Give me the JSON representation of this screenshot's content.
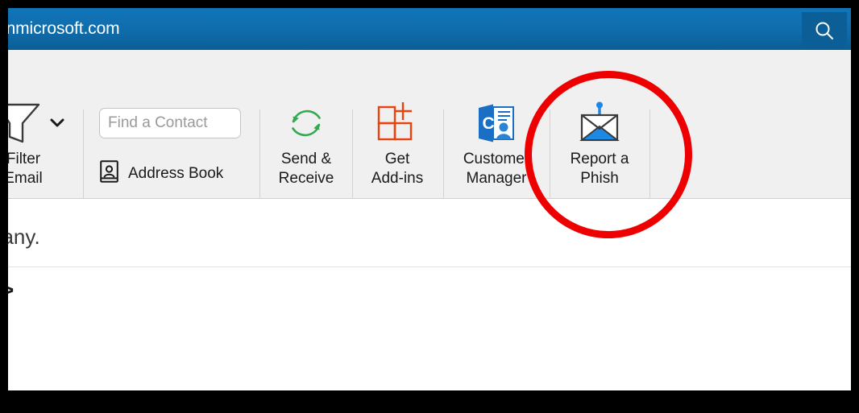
{
  "window": {
    "titlebar": {
      "text": "onmicrosoft.com",
      "search_icon": "search-icon",
      "background_color": "#0f6cab"
    }
  },
  "toolbar": {
    "groups": [
      {
        "id": "filter-email",
        "label": "Filter\nEmail",
        "label_line1": "Filter",
        "label_line2": "Email",
        "icon": "funnel-icon",
        "has_dropdown": true,
        "dropdown_icon": "chevron-down-icon",
        "icon_color": "#ffffff",
        "clipped": true
      },
      {
        "id": "contacts",
        "find_contact": {
          "placeholder": "Find a Contact",
          "value": ""
        },
        "address_book": {
          "label": "Address Book",
          "icon": "address-book-icon"
        }
      },
      {
        "id": "send-receive",
        "label_line1": "Send &",
        "label_line2": "Receive",
        "icon": "refresh-circle-icon",
        "icon_color": "#34a853"
      },
      {
        "id": "get-addins",
        "label_line1": "Get",
        "label_line2": "Add-ins",
        "icon": "grid-plus-icon",
        "icon_color": "#e8430f"
      },
      {
        "id": "customer-manager",
        "label_line1": "Customer",
        "label_line2": "Manager",
        "icon": "outlook-customer-manager-icon",
        "icon_color": "#1a6fc4"
      },
      {
        "id": "report-a-phish",
        "label_line1": "Report a",
        "label_line2": "Phish",
        "icon": "phish-envelope-hook-icon",
        "icon_color": "#1e88e5",
        "highlighted": true
      }
    ]
  },
  "body": {
    "line_1": "pany.",
    "line_2": ">"
  },
  "annotation": {
    "shape": "circle",
    "color": "#ef0000",
    "targets": "report-a-phish"
  }
}
